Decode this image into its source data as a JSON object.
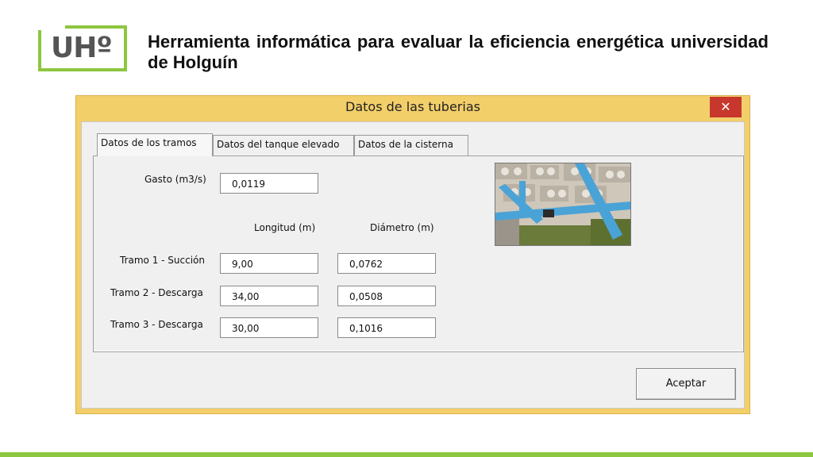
{
  "slide": {
    "logo_text": "UHº",
    "title": "Herramienta informática para evaluar la eficiencia energética universidad de Holguín"
  },
  "dialog": {
    "title": "Datos de las tuberias",
    "close_glyph": "✕",
    "tabs": [
      {
        "label": "Datos de los tramos",
        "active": true
      },
      {
        "label": "Datos del tanque elevado",
        "active": false
      },
      {
        "label": "Datos de la cisterna",
        "active": false
      }
    ],
    "gasto": {
      "label": "Gasto (m3/s)",
      "value": "0,0119"
    },
    "columns": {
      "longitud": "Longitud (m)",
      "diametro": "Diámetro (m)"
    },
    "tramos": [
      {
        "label": "Tramo 1 - Succión",
        "longitud": "9,00",
        "diametro": "0,0762"
      },
      {
        "label": "Tramo 2 - Descarga",
        "longitud": "34,00",
        "diametro": "0,0508"
      },
      {
        "label": "Tramo 3 - Descarga",
        "longitud": "30,00",
        "diametro": "0,1016"
      }
    ],
    "ok_label": "Aceptar"
  },
  "colors": {
    "brand_green": "#8dc63f",
    "dialog_frame": "#f3cf6a",
    "close_red": "#c7372d"
  }
}
